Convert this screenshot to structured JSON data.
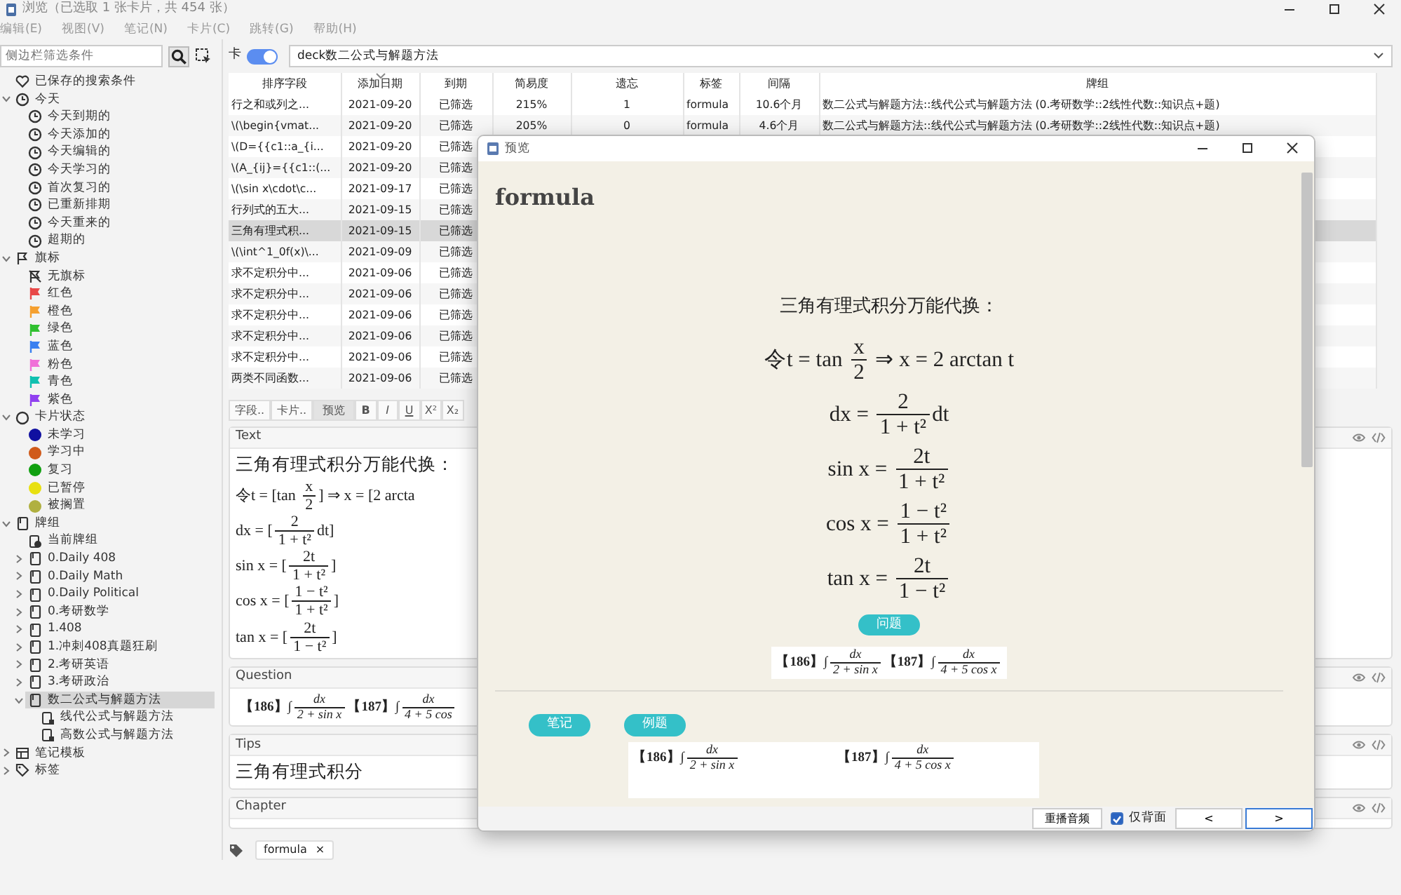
{
  "window": {
    "title": "浏览（已选取 1 张卡片，共 454 张）"
  },
  "menu": [
    "编辑(E)",
    "视图(V)",
    "笔记(N)",
    "卡片(C)",
    "跳转(G)",
    "帮助(H)"
  ],
  "sidebar": {
    "search": {
      "placeholder": "侧边栏筛选条件"
    },
    "items": [
      {
        "label": "已保存的搜索条件",
        "kind": "saved",
        "selected": false
      },
      {
        "label": "今天",
        "kind": "clock",
        "selected": false,
        "expanded": true,
        "children": [
          {
            "label": "今天到期的",
            "kind": "clock",
            "selected": false
          },
          {
            "label": "今天添加的",
            "kind": "clock",
            "selected": false
          },
          {
            "label": "今天编辑的",
            "kind": "clock",
            "selected": false
          },
          {
            "label": "今天学习的",
            "kind": "clock",
            "selected": false
          },
          {
            "label": "首次复习的",
            "kind": "clock",
            "selected": false
          },
          {
            "label": "已重新排期",
            "kind": "clock",
            "selected": false
          },
          {
            "label": "今天重来的",
            "kind": "clock",
            "selected": false
          },
          {
            "label": "超期的",
            "kind": "clock",
            "selected": false
          }
        ]
      },
      {
        "label": "旗标",
        "kind": "flag-group",
        "selected": false,
        "expanded": true,
        "children": [
          {
            "label": "无旗标",
            "kind": "no-flag",
            "selected": false
          },
          {
            "label": "红色",
            "kind": "flag",
            "color": "#e84848",
            "selected": false
          },
          {
            "label": "橙色",
            "kind": "flag",
            "color": "#f5a030",
            "selected": false
          },
          {
            "label": "绿色",
            "kind": "flag",
            "color": "#30c030",
            "selected": false
          },
          {
            "label": "蓝色",
            "kind": "flag",
            "color": "#3a80f0",
            "selected": false
          },
          {
            "label": "粉色",
            "kind": "flag",
            "color": "#f070d8",
            "selected": false
          },
          {
            "label": "青色",
            "kind": "flag",
            "color": "#10c0b0",
            "selected": false
          },
          {
            "label": "紫色",
            "kind": "flag",
            "color": "#9040f0",
            "selected": false
          }
        ]
      },
      {
        "label": "卡片状态",
        "kind": "state-group",
        "selected": false,
        "expanded": true,
        "children": [
          {
            "label": "未学习",
            "kind": "state",
            "color": "#1010a0",
            "selected": false
          },
          {
            "label": "学习中",
            "kind": "state",
            "color": "#d05a1a",
            "selected": false
          },
          {
            "label": "复习",
            "kind": "state",
            "color": "#10a010",
            "selected": false
          },
          {
            "label": "已暂停",
            "kind": "state",
            "color": "#e8e010",
            "selected": false
          },
          {
            "label": "被搁置",
            "kind": "state",
            "color": "#b0b040",
            "selected": false
          }
        ]
      },
      {
        "label": "牌组",
        "kind": "deck",
        "selected": false,
        "expanded": true,
        "children": [
          {
            "label": "当前牌组",
            "kind": "current-deck",
            "selected": false
          },
          {
            "label": "0.Daily 408",
            "kind": "deck",
            "selected": false,
            "expanded": false
          },
          {
            "label": "0.Daily Math",
            "kind": "deck",
            "selected": false,
            "expanded": false
          },
          {
            "label": "0.Daily Political",
            "kind": "deck",
            "selected": false,
            "expanded": false
          },
          {
            "label": "0.考研数学",
            "kind": "deck",
            "selected": false,
            "expanded": false
          },
          {
            "label": "1.408",
            "kind": "deck",
            "selected": false,
            "expanded": false
          },
          {
            "label": "1.冲刺408真题狂刷",
            "kind": "deck",
            "selected": false,
            "expanded": false
          },
          {
            "label": "2.考研英语",
            "kind": "deck",
            "selected": false,
            "expanded": false
          },
          {
            "label": "3.考研政治",
            "kind": "deck",
            "selected": false,
            "expanded": false
          },
          {
            "label": "数二公式与解题方法",
            "kind": "deck",
            "selected": true,
            "expanded": true,
            "children": [
              {
                "label": "线代公式与解题方法",
                "kind": "subdeck",
                "selected": false
              },
              {
                "label": "高数公式与解题方法",
                "kind": "subdeck",
                "selected": false
              }
            ]
          }
        ]
      },
      {
        "label": "笔记模板",
        "kind": "notetype",
        "selected": false,
        "expanded": false
      },
      {
        "label": "标签",
        "kind": "tag",
        "selected": false,
        "expanded": false
      }
    ]
  },
  "mode_toggle": {
    "label": "卡",
    "on": true
  },
  "search": {
    "value": "deck数二公式与解题方法"
  },
  "table": {
    "columns": [
      {
        "label": "排序字段",
        "sorted": false
      },
      {
        "label": "添加日期",
        "sorted": true
      },
      {
        "label": "到期",
        "sorted": false
      },
      {
        "label": "简易度",
        "sorted": false
      },
      {
        "label": "遗忘",
        "sorted": false
      },
      {
        "label": "标签",
        "sorted": false
      },
      {
        "label": "间隔",
        "sorted": false
      },
      {
        "label": "牌组",
        "sorted": false
      }
    ],
    "rows": [
      {
        "cells": [
          "行之和或列之...",
          "2021-09-20",
          "已筛选",
          "215%",
          "1",
          "formula",
          "10.6个月",
          "数二公式与解题方法::线代公式与解题方法 (0.考研数学::2线性代数::知识点+题)"
        ],
        "selected": false
      },
      {
        "cells": [
          "\\(\\begin{vmat...",
          "2021-09-20",
          "已筛选",
          "205%",
          "0",
          "formula",
          "4.6个月",
          "数二公式与解题方法::线代公式与解题方法 (0.考研数学::2线性代数::知识点+题)"
        ],
        "selected": false
      },
      {
        "cells": [
          "\\(D={{c1::a_{i...",
          "2021-09-20",
          "已筛选"
        ],
        "selected": false
      },
      {
        "cells": [
          "\\(A_{ij}={{c1::(...",
          "2021-09-20",
          "已筛选"
        ],
        "selected": false
      },
      {
        "cells": [
          "\\(\\sin x\\cdot\\c...",
          "2021-09-17",
          "已筛选"
        ],
        "selected": false
      },
      {
        "cells": [
          "行列式的五大...",
          "2021-09-15",
          "已筛选"
        ],
        "selected": false
      },
      {
        "cells": [
          "三角有理式积...",
          "2021-09-15",
          "已筛选"
        ],
        "selected": true
      },
      {
        "cells": [
          "\\(\\int^1_0f(x)\\...",
          "2021-09-09",
          "已筛选"
        ],
        "selected": false
      },
      {
        "cells": [
          "求不定积分中...",
          "2021-09-06",
          "已筛选"
        ],
        "selected": false
      },
      {
        "cells": [
          "求不定积分中...",
          "2021-09-06",
          "已筛选"
        ],
        "selected": false
      },
      {
        "cells": [
          "求不定积分中...",
          "2021-09-06",
          "已筛选"
        ],
        "selected": false
      },
      {
        "cells": [
          "求不定积分中...",
          "2021-09-06",
          "已筛选"
        ],
        "selected": false
      },
      {
        "cells": [
          "求不定积分中...",
          "2021-09-06",
          "已筛选"
        ],
        "selected": false
      },
      {
        "cells": [
          "两类不同函数...",
          "2021-09-06",
          "已筛选"
        ],
        "selected": false
      }
    ]
  },
  "editor": {
    "toolbar": [
      {
        "label": "字段..",
        "kind": "text",
        "pressed": false
      },
      {
        "label": "卡片..",
        "kind": "text",
        "pressed": false
      },
      {
        "label": "预览",
        "kind": "text",
        "pressed": true
      },
      {
        "label": "B",
        "kind": "bold"
      },
      {
        "label": "I",
        "kind": "italic"
      },
      {
        "label": "U",
        "kind": "underline"
      },
      {
        "label": "X²",
        "kind": "format"
      },
      {
        "label": "X₂",
        "kind": "format"
      }
    ],
    "fields": [
      {
        "label": "Text",
        "content": [
          {
            "kind": "text",
            "text": "三角有理式积分万能代换："
          },
          {
            "kind": "formula",
            "parts": [
              {
                "kind": "text",
                "text": "令t = [tan "
              },
              {
                "kind": "frac",
                "num": "x",
                "den": "2"
              },
              {
                "kind": "text",
                "text": "] ⇒ x = [2 arcta"
              }
            ]
          },
          {
            "kind": "formula",
            "parts": [
              {
                "kind": "text",
                "text": "dx = ["
              },
              {
                "kind": "frac",
                "num": "2",
                "den": "1 + t²"
              },
              {
                "kind": "text",
                "text": "dt]"
              }
            ]
          },
          {
            "kind": "formula",
            "parts": [
              {
                "kind": "text",
                "text": "sin x = ["
              },
              {
                "kind": "frac",
                "num": "2t",
                "den": "1 + t²"
              },
              {
                "kind": "text",
                "text": "]"
              }
            ]
          },
          {
            "kind": "formula",
            "parts": [
              {
                "kind": "text",
                "text": "cos x = ["
              },
              {
                "kind": "frac",
                "num": "1 − t²",
                "den": "1 + t²"
              },
              {
                "kind": "text",
                "text": "]"
              }
            ]
          },
          {
            "kind": "formula",
            "parts": [
              {
                "kind": "text",
                "text": "tan x = ["
              },
              {
                "kind": "frac",
                "num": "2t",
                "den": "1 − t²"
              },
              {
                "kind": "text",
                "text": "]"
              }
            ]
          }
        ]
      },
      {
        "label": "Question",
        "content": [
          {
            "kind": "image-formula",
            "parts": [
              {
                "kind": "text",
                "text": "【186】∫"
              },
              {
                "kind": "frac",
                "num": "dx",
                "den": "2 + sin x"
              },
              {
                "kind": "text",
                "text": "【187】∫"
              },
              {
                "kind": "frac",
                "num": "dx",
                "den": "4 + 5 cos"
              }
            ]
          }
        ]
      },
      {
        "label": "Tips",
        "content": [
          {
            "kind": "text",
            "text": "三角有理式积分"
          }
        ]
      },
      {
        "label": "Chapter"
      }
    ],
    "tags": [
      {
        "label": "formula",
        "remove": "×"
      }
    ]
  },
  "preview": {
    "title": "预览",
    "heading": "formula",
    "front": [
      {
        "kind": "text",
        "text": "三角有理式积分万能代换："
      },
      {
        "kind": "formula",
        "parts": [
          {
            "kind": "text",
            "text": "令t = tan "
          },
          {
            "kind": "frac",
            "num": "x",
            "den": "2"
          },
          {
            "kind": "text",
            "text": " ⇒ x = 2 arctan t"
          }
        ]
      },
      {
        "kind": "formula",
        "parts": [
          {
            "kind": "text",
            "text": "dx = "
          },
          {
            "kind": "frac",
            "num": "2",
            "den": "1 + t²"
          },
          {
            "kind": "text",
            "text": "dt"
          }
        ]
      },
      {
        "kind": "formula",
        "parts": [
          {
            "kind": "text",
            "text": "sin x = "
          },
          {
            "kind": "frac",
            "num": "2t",
            "den": "1 + t²"
          }
        ]
      },
      {
        "kind": "formula",
        "parts": [
          {
            "kind": "text",
            "text": "cos x = "
          },
          {
            "kind": "frac",
            "num": "1 − t²",
            "den": "1 + t²"
          }
        ]
      },
      {
        "kind": "formula",
        "parts": [
          {
            "kind": "text",
            "text": "tan x = "
          },
          {
            "kind": "frac",
            "num": "2t",
            "den": "1 − t²"
          }
        ]
      },
      {
        "kind": "pill",
        "text": "问题"
      },
      {
        "kind": "image-formula",
        "parts": [
          {
            "kind": "text",
            "text": "【186】∫"
          },
          {
            "kind": "frac",
            "num": "dx",
            "den": "2 + sin x"
          },
          {
            "kind": "text",
            "text": "【187】∫"
          },
          {
            "kind": "frac",
            "num": "dx",
            "den": "4 + 5 cos x"
          }
        ]
      }
    ],
    "pills": [
      "笔记",
      "例题"
    ],
    "examples": [
      {
        "parts": [
          {
            "kind": "text",
            "text": "【186】∫"
          },
          {
            "kind": "frac",
            "num": "dx",
            "den": "2 + sin x"
          }
        ]
      },
      {
        "parts": [
          {
            "kind": "text",
            "text": "【187】∫"
          },
          {
            "kind": "frac",
            "num": "dx",
            "den": "4 + 5 cos x"
          }
        ]
      }
    ],
    "replay_button": "重播音频",
    "back_only": {
      "label": "仅背面",
      "checked": true
    },
    "nav": [
      {
        "label": "<",
        "focused": false
      },
      {
        "label": ">",
        "focused": true
      }
    ]
  }
}
